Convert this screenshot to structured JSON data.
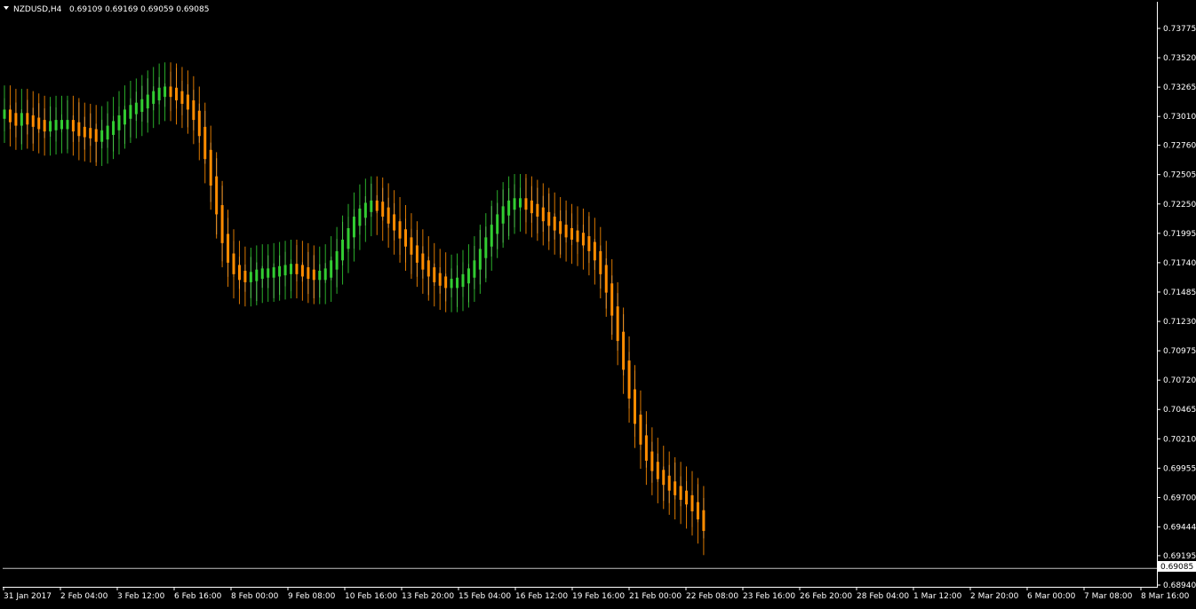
{
  "header": {
    "symbol_timeframe": "NZDUSD,H4",
    "ohlc": "0.69109 0.69169 0.69059 0.69085"
  },
  "colors": {
    "background": "#000000",
    "axis": "#ffffff",
    "bull": "#32cd32",
    "bear": "#ff8c00",
    "wick": "#a0a0a0",
    "price_line": "#c0c0c0"
  },
  "chart_data": {
    "type": "candlestick",
    "title": "NZDUSD,H4",
    "ylim": [
      0.6894,
      0.7398
    ],
    "y_ticks": [
      "0.73775",
      "0.73520",
      "0.73265",
      "0.73010",
      "0.72760",
      "0.72505",
      "0.72250",
      "0.71995",
      "0.71740",
      "0.71485",
      "0.71230",
      "0.70975",
      "0.70720",
      "0.70465",
      "0.70210",
      "0.69955",
      "0.69700",
      "0.69444",
      "0.69195",
      "0.68940"
    ],
    "x_ticks": [
      "31 Jan 2017",
      "2 Feb 04:00",
      "3 Feb 12:00",
      "6 Feb 16:00",
      "8 Feb 00:00",
      "9 Feb 08:00",
      "10 Feb 16:00",
      "13 Feb 20:00",
      "15 Feb 04:00",
      "16 Feb 12:00",
      "19 Feb 16:00",
      "21 Feb 00:00",
      "22 Feb 08:00",
      "23 Feb 16:00",
      "26 Feb 20:00",
      "28 Feb 04:00",
      "1 Mar 12:00",
      "2 Mar 20:00",
      "6 Mar 00:00",
      "7 Mar 08:00",
      "8 Mar 16:00"
    ],
    "current_price": "0.69085",
    "smoothed_close": [
      0.7303,
      0.73,
      0.7297,
      0.73,
      0.7298,
      0.7296,
      0.7294,
      0.7292,
      0.7293,
      0.7294,
      0.7294,
      0.7294,
      0.7292,
      0.7288,
      0.7287,
      0.7286,
      0.7283,
      0.7285,
      0.7289,
      0.7293,
      0.7298,
      0.7303,
      0.7307,
      0.7309,
      0.7312,
      0.7316,
      0.7319,
      0.7322,
      0.7323,
      0.7322,
      0.7319,
      0.7316,
      0.7311,
      0.7302,
      0.7288,
      0.7268,
      0.7245,
      0.722,
      0.7195,
      0.7178,
      0.7168,
      0.7163,
      0.7161,
      0.7162,
      0.7164,
      0.7165,
      0.7165,
      0.7166,
      0.7167,
      0.7168,
      0.7169,
      0.7168,
      0.7166,
      0.7164,
      0.7163,
      0.7163,
      0.7165,
      0.7172,
      0.718,
      0.719,
      0.72,
      0.721,
      0.7217,
      0.7222,
      0.7224,
      0.7223,
      0.7218,
      0.7212,
      0.7206,
      0.7199,
      0.7192,
      0.7185,
      0.7178,
      0.7172,
      0.7166,
      0.7161,
      0.7158,
      0.7156,
      0.7156,
      0.7157,
      0.716,
      0.7165,
      0.7172,
      0.7182,
      0.7192,
      0.7203,
      0.7212,
      0.7219,
      0.7224,
      0.7226,
      0.7226,
      0.7224,
      0.7221,
      0.7218,
      0.7214,
      0.721,
      0.7206,
      0.7203,
      0.72,
      0.7198,
      0.7196,
      0.7193,
      0.7188,
      0.718,
      0.7168,
      0.7152,
      0.7132,
      0.711,
      0.7085,
      0.706,
      0.7038,
      0.702,
      0.7006,
      0.6997,
      0.699,
      0.6985,
      0.698,
      0.6976,
      0.6972,
      0.6968,
      0.6962,
      0.6955,
      0.6945
    ]
  }
}
